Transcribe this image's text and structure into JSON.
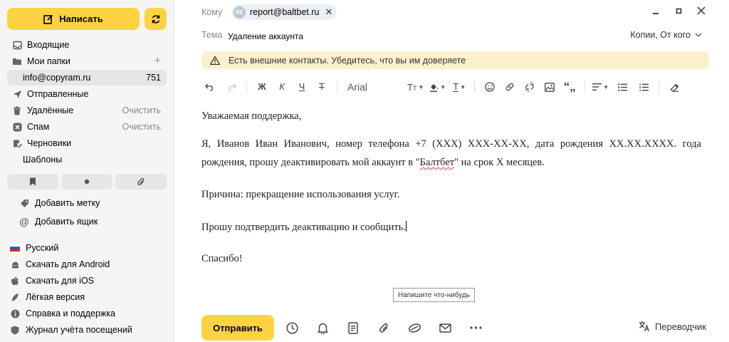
{
  "sidebar": {
    "compose_label": "Написать",
    "folders": [
      {
        "label": "Входящие"
      },
      {
        "label": "Мои папки",
        "aux": "+"
      },
      {
        "label": "info@copyram.ru",
        "count": "751"
      },
      {
        "label": "Отправленные"
      },
      {
        "label": "Удалённые",
        "aux": "Очистить"
      },
      {
        "label": "Спам",
        "aux": "Очистить"
      },
      {
        "label": "Черновики"
      },
      {
        "label": "Шаблоны"
      }
    ],
    "add_label": "Добавить метку",
    "add_box": "Добавить ящик",
    "footer": [
      {
        "label": "Русский"
      },
      {
        "label": "Скачать для Android"
      },
      {
        "label": "Скачать для iOS"
      },
      {
        "label": "Лёгкая версия"
      },
      {
        "label": "Справка и поддержка"
      },
      {
        "label": "Журнал учёта посещений"
      }
    ]
  },
  "compose": {
    "to_label": "Кому",
    "recipient_initials": "RE",
    "recipient": "report@baltbet.ru",
    "subject_label": "Тема",
    "subject": "Удаление аккаунта",
    "cc_label": "Копии, От кого",
    "warning": "Есть внешние контакты. Убедитесь, что вы им доверяете",
    "toolbar": {
      "bold": "Ж",
      "italic": "К",
      "underline": "Ч",
      "strike": "Т",
      "font": "Arial"
    },
    "body": {
      "greeting": "Уважаемая поддержка,",
      "para1_pre": "Я, Иванов Иван Иванович, номер телефона +7 (XXX) XXX-XX-XX, дата рождения XX.XX.XXXX. года рождения, прошу деактивировать мой аккаунт в \"",
      "para1_brand": "Балтбет",
      "para1_post": "\" на срок X месяцев.",
      "reason": "Причина: прекращение использования услуг.",
      "request": "Прошу подтвердить деактивацию и сообщить.",
      "thanks": "Спасибо!"
    },
    "tooltip": "Напишите что-нибудь",
    "send_label": "Отправить",
    "translator_label": "Переводчик"
  },
  "colors": {
    "accent": "#fed342",
    "warning_bg": "#fdf0cc",
    "sidebar_bg": "#f5f5f5"
  }
}
